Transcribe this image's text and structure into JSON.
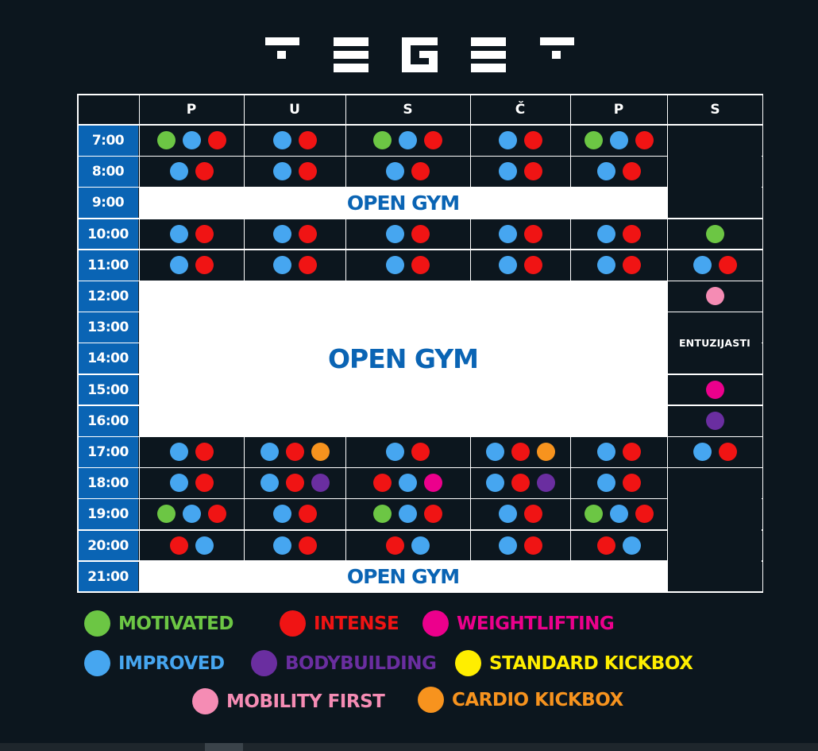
{
  "brand": {
    "name": "TEGET"
  },
  "colors": {
    "background": "#0c161e",
    "time_cell": "#0a64b4",
    "open_gym_text": "#0a64b4",
    "motivated": "#6cc644",
    "intense": "#f01414",
    "weightlifting": "#ec008c",
    "improved": "#46a6f0",
    "bodybuilding": "#6a2ea0",
    "standard_kickbox": "#ffee00",
    "mobility_first": "#f58cb4",
    "cardio_kickbox": "#f7931e"
  },
  "days": [
    "P",
    "U",
    "S",
    "Č",
    "P",
    "S"
  ],
  "times": [
    "7:00",
    "8:00",
    "9:00",
    "10:00",
    "11:00",
    "12:00",
    "13:00",
    "14:00",
    "15:00",
    "16:00",
    "17:00",
    "18:00",
    "19:00",
    "20:00",
    "21:00"
  ],
  "open_gym_label": "OPEN GYM",
  "entuzijasti_label": "ENTUZIJASTI",
  "schedule": [
    [
      [
        "motivated",
        "improved",
        "intense"
      ],
      [
        "improved",
        "intense"
      ],
      [
        "motivated",
        "improved",
        "intense"
      ],
      [
        "improved",
        "intense"
      ],
      [
        "motivated",
        "improved",
        "intense"
      ],
      null
    ],
    [
      [
        "improved",
        "intense"
      ],
      [
        "improved",
        "intense"
      ],
      [
        "improved",
        "intense"
      ],
      [
        "improved",
        "intense"
      ],
      [
        "improved",
        "intense"
      ],
      null
    ],
    [
      null,
      null,
      null,
      null,
      null,
      null
    ],
    [
      [
        "improved",
        "intense"
      ],
      [
        "improved",
        "intense"
      ],
      [
        "improved",
        "intense"
      ],
      [
        "improved",
        "intense"
      ],
      [
        "improved",
        "intense"
      ],
      [
        "motivated"
      ]
    ],
    [
      [
        "improved",
        "intense"
      ],
      [
        "improved",
        "intense"
      ],
      [
        "improved",
        "intense"
      ],
      [
        "improved",
        "intense"
      ],
      [
        "improved",
        "intense"
      ],
      [
        "improved",
        "intense"
      ]
    ],
    [
      null,
      null,
      null,
      null,
      null,
      [
        "mobility_first"
      ]
    ],
    [
      null,
      null,
      null,
      null,
      null,
      null
    ],
    [
      null,
      null,
      null,
      null,
      null,
      null
    ],
    [
      null,
      null,
      null,
      null,
      null,
      [
        "weightlifting"
      ]
    ],
    [
      null,
      null,
      null,
      null,
      null,
      [
        "bodybuilding"
      ]
    ],
    [
      [
        "improved",
        "intense"
      ],
      [
        "improved",
        "intense",
        "cardio_kickbox"
      ],
      [
        "improved",
        "intense"
      ],
      [
        "improved",
        "intense",
        "cardio_kickbox"
      ],
      [
        "improved",
        "intense"
      ],
      [
        "improved",
        "intense"
      ]
    ],
    [
      [
        "improved",
        "intense"
      ],
      [
        "improved",
        "intense",
        "bodybuilding"
      ],
      [
        "intense",
        "improved",
        "weightlifting"
      ],
      [
        "improved",
        "intense",
        "bodybuilding"
      ],
      [
        "improved",
        "intense"
      ],
      null
    ],
    [
      [
        "motivated",
        "improved",
        "intense"
      ],
      [
        "improved",
        "intense"
      ],
      [
        "motivated",
        "improved",
        "intense"
      ],
      [
        "improved",
        "intense"
      ],
      [
        "motivated",
        "improved",
        "intense"
      ],
      null
    ],
    [
      [
        "intense",
        "improved"
      ],
      [
        "improved",
        "intense"
      ],
      [
        "intense",
        "improved"
      ],
      [
        "improved",
        "intense"
      ],
      [
        "intense",
        "improved"
      ],
      null
    ],
    [
      null,
      null,
      null,
      null,
      null,
      null
    ]
  ],
  "legend": [
    {
      "key": "motivated",
      "label": "MOTIVATED"
    },
    {
      "key": "intense",
      "label": "INTENSE"
    },
    {
      "key": "weightlifting",
      "label": "WEIGHTLIFTING"
    },
    {
      "key": "improved",
      "label": "IMPROVED"
    },
    {
      "key": "bodybuilding",
      "label": "BODYBUILDING"
    },
    {
      "key": "standard_kickbox",
      "label": "STANDARD KICKBOX"
    },
    {
      "key": "mobility_first",
      "label": "MOBILITY FIRST"
    },
    {
      "key": "cardio_kickbox",
      "label": "CARDIO KICKBOX"
    }
  ]
}
